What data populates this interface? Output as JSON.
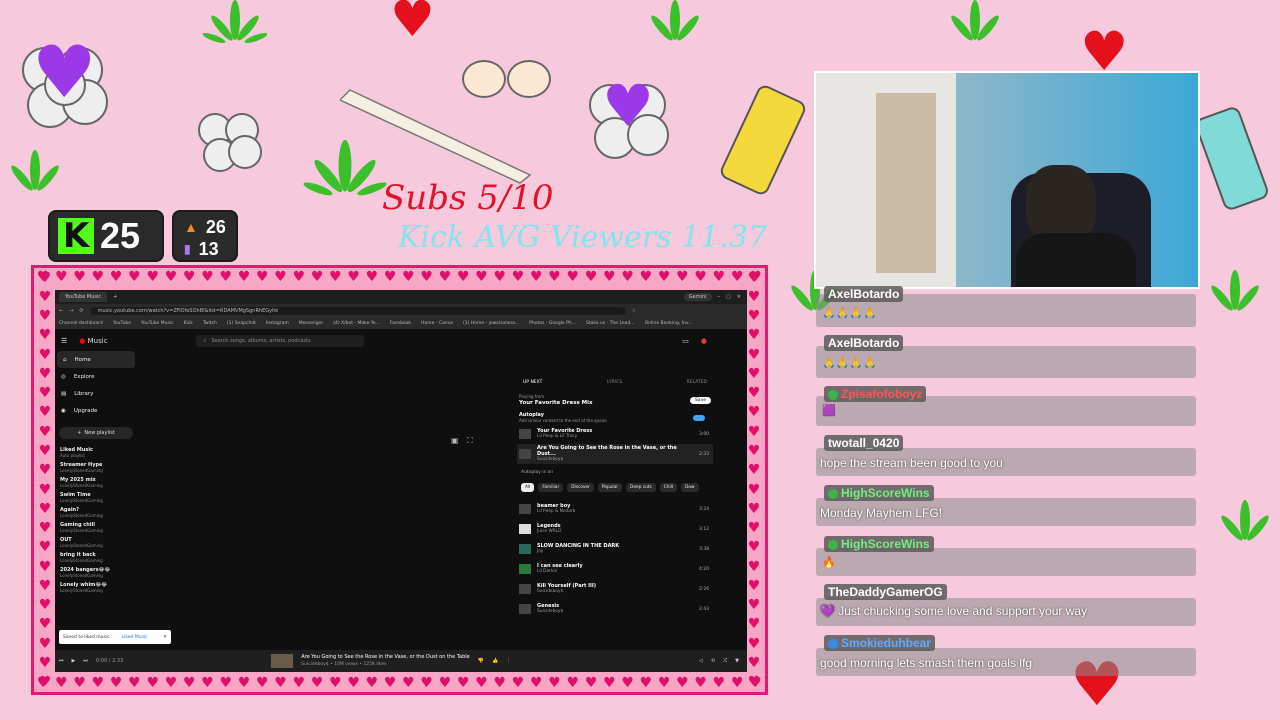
{
  "stream_stats": {
    "kick_logo": "K",
    "kick_viewers": "25",
    "followers": "26",
    "subs_count": "13",
    "subs_goal_text": "Subs 5/10",
    "kick_avg_text": "Kick AVG Viewers 11.37"
  },
  "browser": {
    "tab_title": "YouTube Music",
    "url": "music.youtube.com/watch?v=ZFiOfeSOhBI&list=RDAMVMgSgnRhEGyhk",
    "gemini_label": "Gemini",
    "bookmarks": [
      "Channel dashboard",
      "YouTube",
      "YouTube Music",
      "Kick",
      "Twitch",
      "(1) Snapchat",
      "Instagram",
      "Messenger",
      "(4) X/bot - Make Yo...",
      "Facebook",
      "Home - Canva",
      "(1) Home - jews/solana...",
      "Photos - Google Ph...",
      "Stake.us - The Lead...",
      "Online Banking, Inv..."
    ]
  },
  "ytmusic": {
    "logo": "Music",
    "search_placeholder": "Search songs, albums, artists, podcasts",
    "nav": [
      {
        "label": "Home",
        "icon": "home-icon"
      },
      {
        "label": "Explore",
        "icon": "compass-icon"
      },
      {
        "label": "Library",
        "icon": "library-icon"
      },
      {
        "label": "Upgrade",
        "icon": "upgrade-icon"
      }
    ],
    "new_playlist": "New playlist",
    "playlists": [
      {
        "title": "Liked Music",
        "sub": "Auto playlist"
      },
      {
        "title": "Streamer Hype",
        "sub": "LonelyStonedGaming"
      },
      {
        "title": "My 2025 mix",
        "sub": "LonelyStonedGaming"
      },
      {
        "title": "Swim Time",
        "sub": "LonelyStonedGaming"
      },
      {
        "title": "Again?",
        "sub": "LonelyStonedGaming"
      },
      {
        "title": "Gaming chill",
        "sub": "LonelyStonedGaming"
      },
      {
        "title": "OUT",
        "sub": "LonelyStonedGaming"
      },
      {
        "title": "bring it back",
        "sub": "LonelyStonedGaming"
      },
      {
        "title": "2024 bangers😂😂",
        "sub": "LonelyStonedGaming"
      },
      {
        "title": "Lonely whim😂😂",
        "sub": "LonelyStonedGaming"
      }
    ],
    "toast_text": "Saved to liked music",
    "toast_link": "Liked Music",
    "queue_tabs": [
      "UP NEXT",
      "LYRICS",
      "RELATED"
    ],
    "playing_from_label": "Playing from",
    "playing_from": "Your Favorite Dress Mix",
    "save_label": "Save",
    "autoplay_label": "Autoplay",
    "autoplay_sub": "Add similar content to the end of the queue",
    "queue_top": [
      {
        "title": "Your Favorite Dress",
        "artist": "Lil Peep & Lil Tracy",
        "dur": "3:00"
      },
      {
        "title": "Are You Going to See the Rose in the Vase, or the Dust...",
        "artist": "Suicideboy$",
        "dur": "2:33"
      }
    ],
    "autoplay_on": "Autoplay is on",
    "chips": [
      "All",
      "Familiar",
      "Discover",
      "Popular",
      "Deep cuts",
      "Chill",
      "Dow"
    ],
    "queue": [
      {
        "title": "beamer boy",
        "artist": "Lil Peep & Nedarb",
        "dur": "3:24"
      },
      {
        "title": "Legends",
        "artist": "Juice WRLD",
        "dur": "3:12"
      },
      {
        "title": "SLOW DANCING IN THE DARK",
        "artist": "Joji",
        "dur": "3:38"
      },
      {
        "title": "I can see clearly",
        "artist": "Lil Darkie",
        "dur": "4:20"
      },
      {
        "title": "Kill Yourself (Part III)",
        "artist": "Suicideboy$",
        "dur": "2:26"
      },
      {
        "title": "Genesis",
        "artist": "Suicideboy$",
        "dur": "2:43"
      }
    ],
    "player": {
      "time": "0:00 / 2:33",
      "title": "Are You Going to See the Rose in the Vase, or the Dust on the Table",
      "meta": "Suicideboy$ • 10M views • 125K likes"
    }
  },
  "chat": [
    {
      "user": "AxelBotardo",
      "message": ""
    },
    {
      "user": "AxelBotardo",
      "message": ""
    },
    {
      "user": "Zpisafofoboyz",
      "message": ""
    },
    {
      "user": "twotall_0420",
      "message": "hope the stream been good to you"
    },
    {
      "user": "HighScoreWins",
      "message": "Monday Mayhem LFG!"
    },
    {
      "user": "HighScoreWins",
      "message": ""
    },
    {
      "user": "TheDaddyGamerOG",
      "message": "Just chucking some love and support your way"
    },
    {
      "user": "Smokieduhbear",
      "message": "good morning lets smash them goals lfg"
    }
  ],
  "colors": {
    "background": "#f6c9dc",
    "frame_pink": "#e01a74",
    "kick_green": "#53fc18",
    "subs_red": "#e3122a",
    "avg_cyan": "#6fe8f2"
  }
}
